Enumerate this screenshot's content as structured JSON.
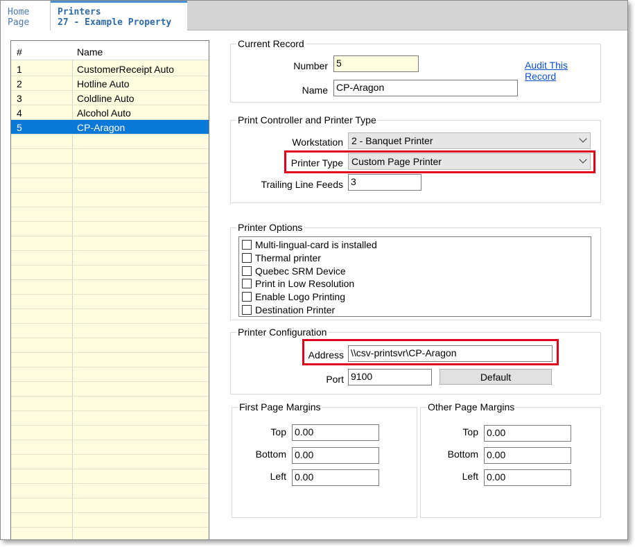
{
  "tabs": {
    "home_line1": "Home",
    "home_line2": "Page",
    "active_line1": "Printers",
    "active_line2": "27 - Example Property"
  },
  "list": {
    "columns": [
      "#",
      "Name"
    ],
    "rows": [
      {
        "num": "1",
        "name": "CustomerReceipt Auto"
      },
      {
        "num": "2",
        "name": "Hotline Auto"
      },
      {
        "num": "3",
        "name": "Coldline Auto"
      },
      {
        "num": "4",
        "name": "Alcohol Auto"
      },
      {
        "num": "5",
        "name": "CP-Aragon"
      }
    ],
    "selected_index": 4
  },
  "current_record": {
    "title": "Current Record",
    "number_label": "Number",
    "number_value": "5",
    "name_label": "Name",
    "name_value": "CP-Aragon",
    "audit_link": "Audit This Record"
  },
  "print_controller": {
    "title": "Print Controller and Printer Type",
    "workstation_label": "Workstation",
    "workstation_value": "2 - Banquet Printer",
    "printer_type_label": "Printer Type",
    "printer_type_value": "Custom Page Printer",
    "trailing_label": "Trailing Line Feeds",
    "trailing_value": "3"
  },
  "printer_options": {
    "title": "Printer Options",
    "items": [
      {
        "label": "Multi-lingual-card is installed",
        "checked": false
      },
      {
        "label": "Thermal printer",
        "checked": false
      },
      {
        "label": "Quebec SRM Device",
        "checked": false
      },
      {
        "label": "Print in Low Resolution",
        "checked": false
      },
      {
        "label": "Enable Logo Printing",
        "checked": false
      },
      {
        "label": "Destination Printer",
        "checked": false
      }
    ]
  },
  "printer_configuration": {
    "title": "Printer Configuration",
    "address_label": "Address",
    "address_value": "\\\\csv-printsvr\\CP-Aragon",
    "port_label": "Port",
    "port_value": "9100",
    "default_button": "Default"
  },
  "first_page_margins": {
    "title": "First Page Margins",
    "top_label": "Top",
    "top_value": "0.00",
    "bottom_label": "Bottom",
    "bottom_value": "0.00",
    "left_label": "Left",
    "left_value": "0.00"
  },
  "other_page_margins": {
    "title": "Other Page Margins",
    "top_label": "Top",
    "top_value": "0.00",
    "bottom_label": "Bottom",
    "bottom_value": "0.00",
    "left_label": "Left",
    "left_value": "0.00"
  },
  "colors": {
    "selection": "#0a78d7",
    "list_background": "#fffde0",
    "highlight_box": "#e0001b",
    "link": "#0b4fd8"
  }
}
